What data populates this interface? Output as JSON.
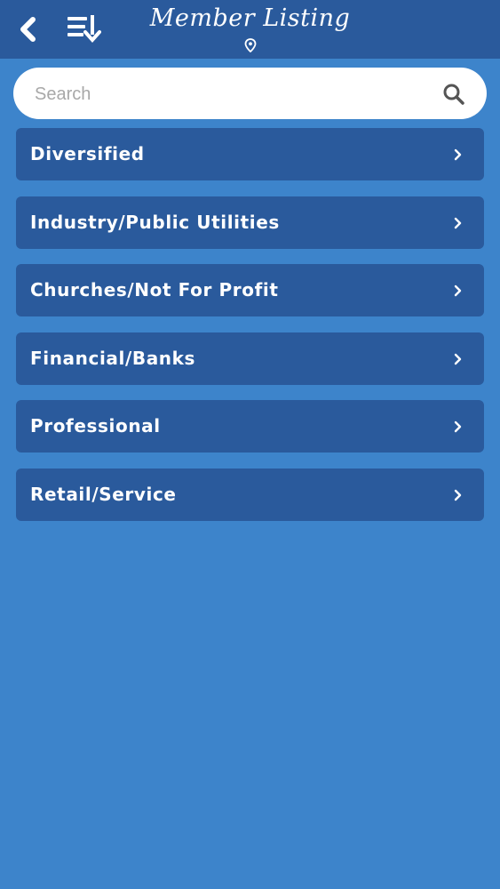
{
  "header": {
    "title": "Member Listing",
    "back_icon": "chevron-left-icon",
    "sort_icon": "sort-list-icon",
    "location_icon": "location-pin-icon"
  },
  "search": {
    "value": "",
    "placeholder": "Search"
  },
  "categories": [
    {
      "label": "Diversified"
    },
    {
      "label": "Industry/Public Utilities"
    },
    {
      "label": "Churches/Not For Profit"
    },
    {
      "label": "Financial/Banks"
    },
    {
      "label": "Professional"
    },
    {
      "label": "Retail/Service"
    }
  ],
  "colors": {
    "background": "#3d84cb",
    "header": "#2a5a9c",
    "item": "#2a5a9c",
    "text": "#ffffff",
    "placeholder": "#a8a8a8"
  }
}
